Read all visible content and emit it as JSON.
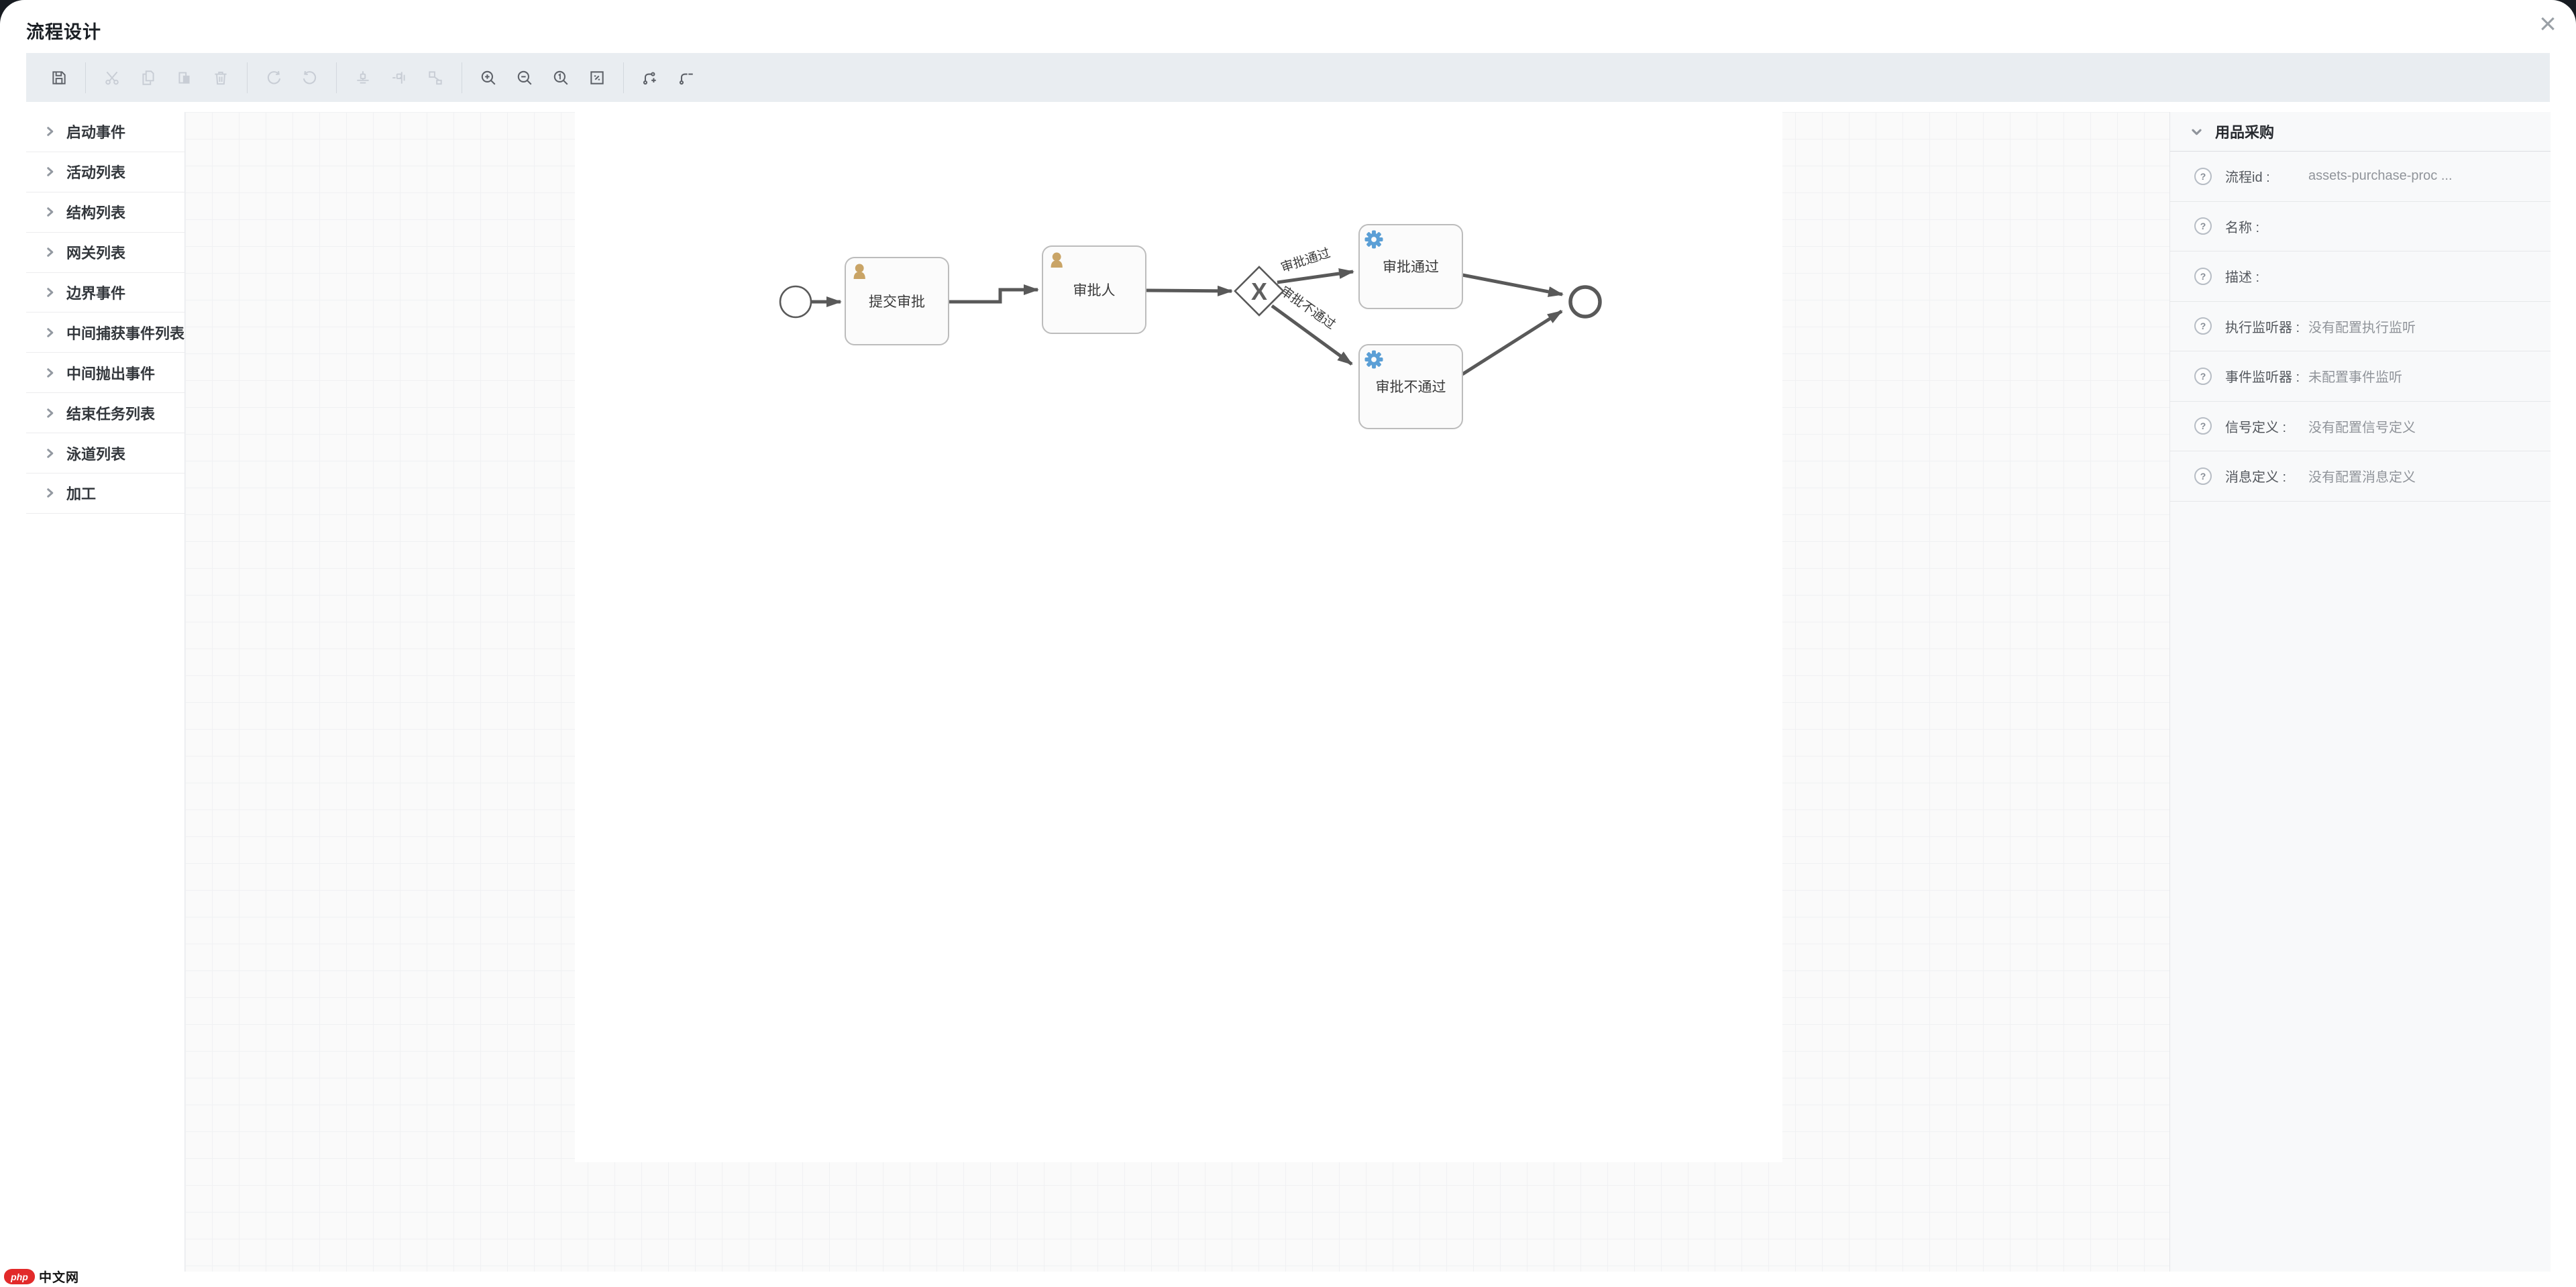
{
  "window": {
    "title": "流程设计",
    "close_glyph": "×"
  },
  "toolbar": {
    "buttons": [
      {
        "name": "save",
        "enabled": true
      },
      {
        "name": "cut",
        "enabled": false
      },
      {
        "name": "copy",
        "enabled": false
      },
      {
        "name": "paste",
        "enabled": false
      },
      {
        "name": "delete",
        "enabled": false
      },
      {
        "name": "redo",
        "enabled": false
      },
      {
        "name": "undo",
        "enabled": false
      },
      {
        "name": "align-vertical-center",
        "enabled": false
      },
      {
        "name": "align-horizontal-center",
        "enabled": false
      },
      {
        "name": "auto-layout",
        "enabled": false
      },
      {
        "name": "zoom-in",
        "enabled": true
      },
      {
        "name": "zoom-out",
        "enabled": true
      },
      {
        "name": "zoom-reset",
        "enabled": true
      },
      {
        "name": "fit-screen",
        "enabled": true
      },
      {
        "name": "add-connection",
        "enabled": true
      },
      {
        "name": "remove-connection",
        "enabled": true
      }
    ]
  },
  "sidebar": {
    "items": [
      {
        "label": "启动事件"
      },
      {
        "label": "活动列表"
      },
      {
        "label": "结构列表"
      },
      {
        "label": "网关列表"
      },
      {
        "label": "边界事件"
      },
      {
        "label": "中间捕获事件列表"
      },
      {
        "label": "中间抛出事件"
      },
      {
        "label": "结束任务列表"
      },
      {
        "label": "泳道列表"
      },
      {
        "label": "加工"
      }
    ]
  },
  "diagram": {
    "nodes": {
      "start": {
        "type": "start-event",
        "label": ""
      },
      "submit": {
        "type": "user-task",
        "label": "提交审批"
      },
      "approver": {
        "type": "user-task",
        "label": "审批人"
      },
      "gateway": {
        "type": "exclusive-gateway",
        "label": "X"
      },
      "approve": {
        "type": "service-task",
        "label": "审批通过"
      },
      "reject": {
        "type": "service-task",
        "label": "审批不通过"
      },
      "end": {
        "type": "end-event",
        "label": ""
      }
    },
    "edge_labels": {
      "pass": "审批通过",
      "fail": "审批不通过"
    },
    "colors": {
      "edge_stroke": "#595959",
      "user_task_icon": "#c9a466",
      "service_task_icon": "#5b9fd6",
      "task_fill": "#fbfbfb",
      "task_border": "#bcbcbc"
    }
  },
  "panel": {
    "title": "用品采购",
    "rows": [
      {
        "label": "流程id :",
        "value": "assets-purchase-proc ..."
      },
      {
        "label": "名称 :",
        "value": ""
      },
      {
        "label": "描述 :",
        "value": ""
      },
      {
        "label": "执行监听器 :",
        "value": "没有配置执行监听"
      },
      {
        "label": "事件监听器 :",
        "value": "未配置事件监听"
      },
      {
        "label": "信号定义 :",
        "value": "没有配置信号定义"
      },
      {
        "label": "消息定义 :",
        "value": "没有配置消息定义"
      }
    ]
  },
  "watermark": {
    "brand": "php",
    "text": "中文网"
  }
}
